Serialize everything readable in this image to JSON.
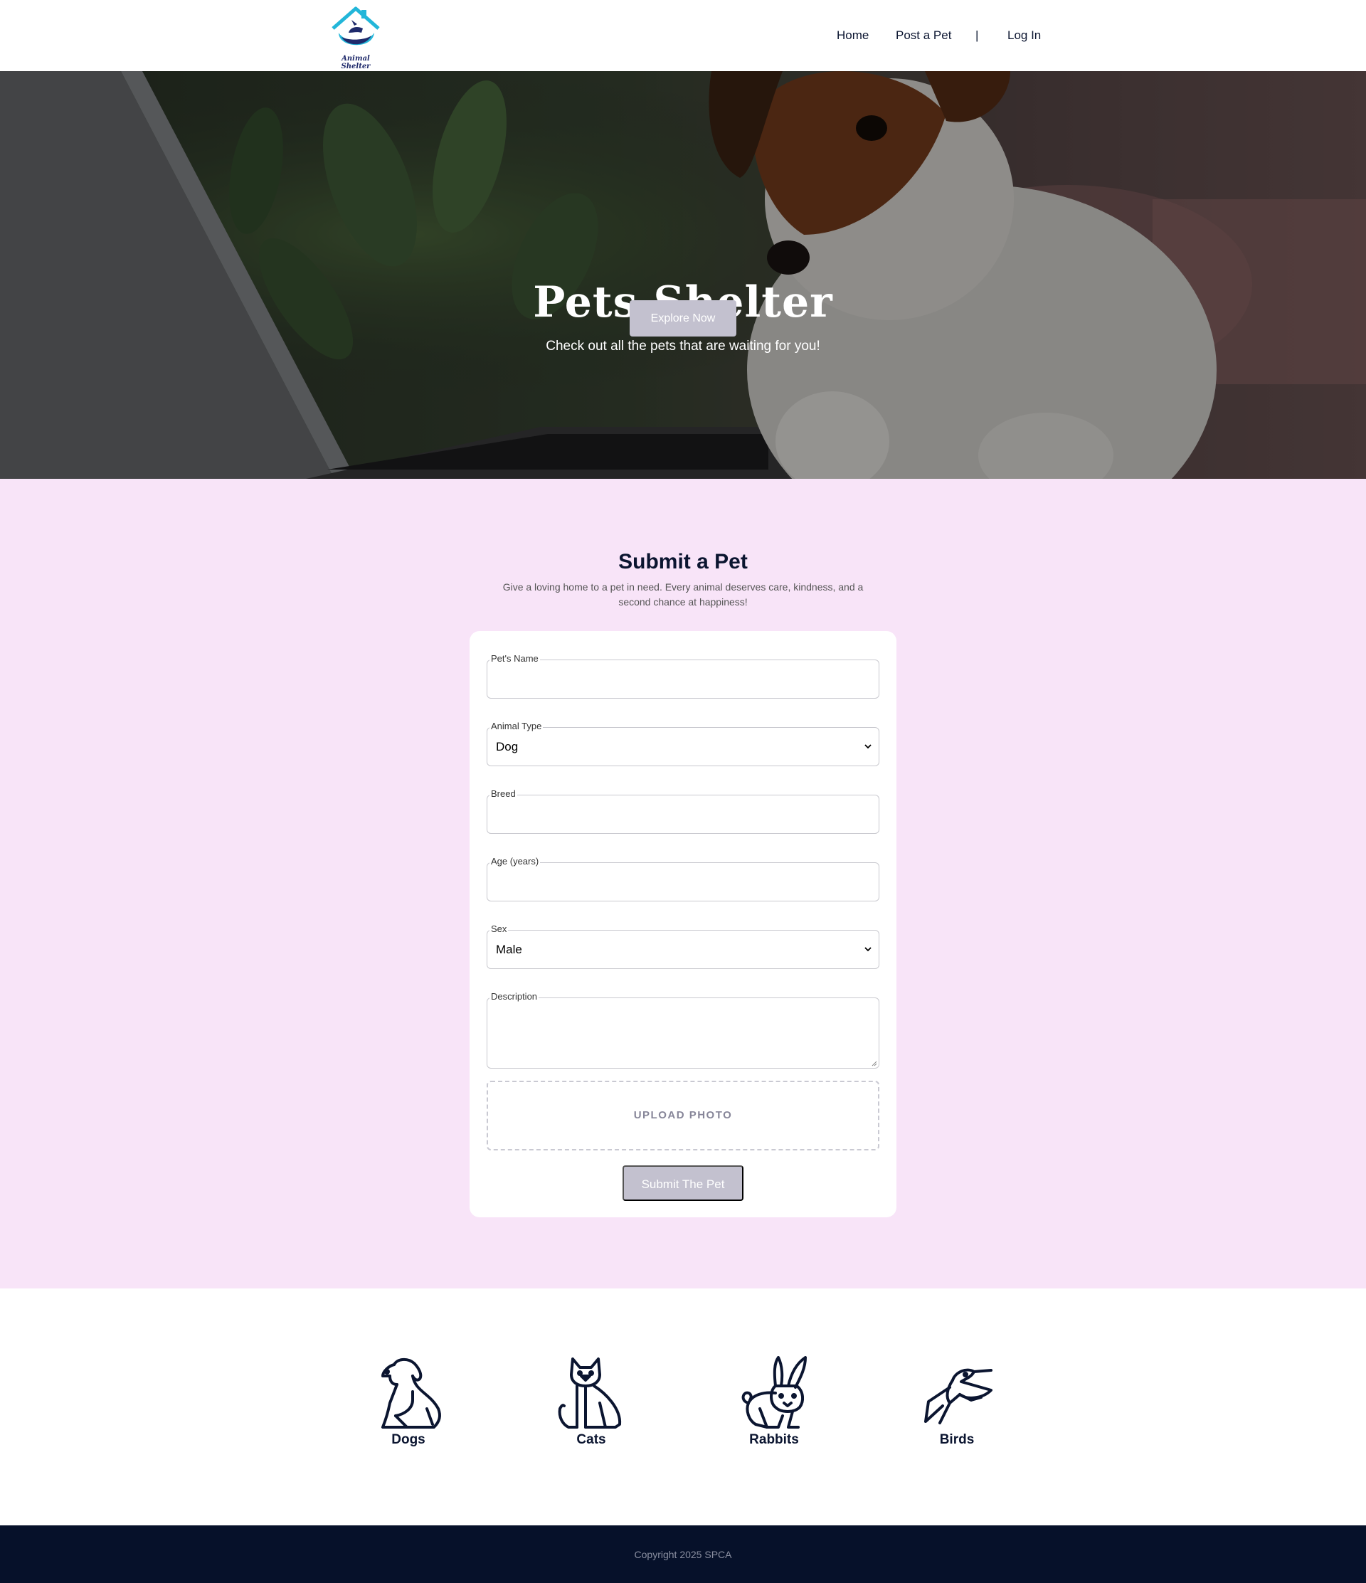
{
  "header": {
    "logo_text": "Animal Shelter",
    "nav": {
      "home": "Home",
      "post": "Post a Pet",
      "separator": "|",
      "login": "Log In"
    }
  },
  "hero": {
    "title": "Pets Shelter",
    "subtitle": "Check out all the pets that are waiting for you!",
    "button": "Explore Now"
  },
  "submit": {
    "title": "Submit a Pet",
    "description": "Give a loving home to a pet in need. Every animal deserves care, kindness, and a second chance at happiness!",
    "fields": {
      "name": {
        "label": "Pet's Name",
        "value": ""
      },
      "type": {
        "label": "Animal Type",
        "value": "Dog"
      },
      "breed": {
        "label": "Breed",
        "value": ""
      },
      "age": {
        "label": "Age (years)",
        "value": ""
      },
      "sex": {
        "label": "Sex",
        "value": "Male"
      },
      "description": {
        "label": "Description",
        "value": ""
      }
    },
    "upload": "UPLOAD PHOTO",
    "submit_button": "Submit The Pet"
  },
  "categories": [
    {
      "label": "Dogs",
      "icon": "dog-icon"
    },
    {
      "label": "Cats",
      "icon": "cat-icon"
    },
    {
      "label": "Rabbits",
      "icon": "rabbit-icon"
    },
    {
      "label": "Birds",
      "icon": "bird-icon"
    }
  ],
  "footer": {
    "copyright": "Copyright 2025 SPCA"
  },
  "colors": {
    "navy": "#0b1530",
    "button": "#c3c1cf",
    "section_bg": "#f8e4f8",
    "footer_bg": "#06112a",
    "logo_teal": "#22b6d9"
  }
}
